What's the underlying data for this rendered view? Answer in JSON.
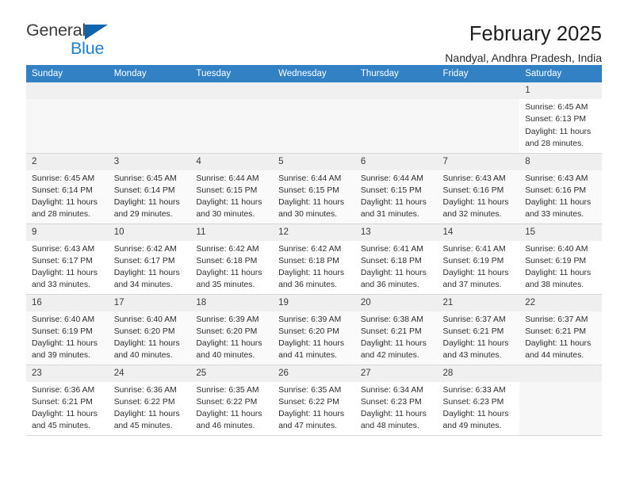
{
  "brand": {
    "name_part1": "General",
    "name_part2": "Blue",
    "accent_color": "#1f7fd0",
    "triangle_color": "#1263ad"
  },
  "header": {
    "title": "February 2025",
    "subtitle": "Nandyal, Andhra Pradesh, India"
  },
  "calendar": {
    "header_bg": "#3281c4",
    "weekdays": [
      "Sunday",
      "Monday",
      "Tuesday",
      "Wednesday",
      "Thursday",
      "Friday",
      "Saturday"
    ],
    "labels": {
      "sunrise": "Sunrise:",
      "sunset": "Sunset:",
      "daylight": "Daylight:"
    },
    "weeks": [
      [
        {
          "day": "",
          "empty": true
        },
        {
          "day": "",
          "empty": true
        },
        {
          "day": "",
          "empty": true
        },
        {
          "day": "",
          "empty": true
        },
        {
          "day": "",
          "empty": true
        },
        {
          "day": "",
          "empty": true
        },
        {
          "day": "1",
          "sunrise": "Sunrise: 6:45 AM",
          "sunset": "Sunset: 6:13 PM",
          "daylight1": "Daylight: 11 hours",
          "daylight2": "and 28 minutes."
        }
      ],
      [
        {
          "day": "2",
          "sunrise": "Sunrise: 6:45 AM",
          "sunset": "Sunset: 6:14 PM",
          "daylight1": "Daylight: 11 hours",
          "daylight2": "and 28 minutes."
        },
        {
          "day": "3",
          "sunrise": "Sunrise: 6:45 AM",
          "sunset": "Sunset: 6:14 PM",
          "daylight1": "Daylight: 11 hours",
          "daylight2": "and 29 minutes."
        },
        {
          "day": "4",
          "sunrise": "Sunrise: 6:44 AM",
          "sunset": "Sunset: 6:15 PM",
          "daylight1": "Daylight: 11 hours",
          "daylight2": "and 30 minutes."
        },
        {
          "day": "5",
          "sunrise": "Sunrise: 6:44 AM",
          "sunset": "Sunset: 6:15 PM",
          "daylight1": "Daylight: 11 hours",
          "daylight2": "and 30 minutes."
        },
        {
          "day": "6",
          "sunrise": "Sunrise: 6:44 AM",
          "sunset": "Sunset: 6:15 PM",
          "daylight1": "Daylight: 11 hours",
          "daylight2": "and 31 minutes."
        },
        {
          "day": "7",
          "sunrise": "Sunrise: 6:43 AM",
          "sunset": "Sunset: 6:16 PM",
          "daylight1": "Daylight: 11 hours",
          "daylight2": "and 32 minutes."
        },
        {
          "day": "8",
          "sunrise": "Sunrise: 6:43 AM",
          "sunset": "Sunset: 6:16 PM",
          "daylight1": "Daylight: 11 hours",
          "daylight2": "and 33 minutes."
        }
      ],
      [
        {
          "day": "9",
          "sunrise": "Sunrise: 6:43 AM",
          "sunset": "Sunset: 6:17 PM",
          "daylight1": "Daylight: 11 hours",
          "daylight2": "and 33 minutes."
        },
        {
          "day": "10",
          "sunrise": "Sunrise: 6:42 AM",
          "sunset": "Sunset: 6:17 PM",
          "daylight1": "Daylight: 11 hours",
          "daylight2": "and 34 minutes."
        },
        {
          "day": "11",
          "sunrise": "Sunrise: 6:42 AM",
          "sunset": "Sunset: 6:18 PM",
          "daylight1": "Daylight: 11 hours",
          "daylight2": "and 35 minutes."
        },
        {
          "day": "12",
          "sunrise": "Sunrise: 6:42 AM",
          "sunset": "Sunset: 6:18 PM",
          "daylight1": "Daylight: 11 hours",
          "daylight2": "and 36 minutes."
        },
        {
          "day": "13",
          "sunrise": "Sunrise: 6:41 AM",
          "sunset": "Sunset: 6:18 PM",
          "daylight1": "Daylight: 11 hours",
          "daylight2": "and 36 minutes."
        },
        {
          "day": "14",
          "sunrise": "Sunrise: 6:41 AM",
          "sunset": "Sunset: 6:19 PM",
          "daylight1": "Daylight: 11 hours",
          "daylight2": "and 37 minutes."
        },
        {
          "day": "15",
          "sunrise": "Sunrise: 6:40 AM",
          "sunset": "Sunset: 6:19 PM",
          "daylight1": "Daylight: 11 hours",
          "daylight2": "and 38 minutes."
        }
      ],
      [
        {
          "day": "16",
          "sunrise": "Sunrise: 6:40 AM",
          "sunset": "Sunset: 6:19 PM",
          "daylight1": "Daylight: 11 hours",
          "daylight2": "and 39 minutes."
        },
        {
          "day": "17",
          "sunrise": "Sunrise: 6:40 AM",
          "sunset": "Sunset: 6:20 PM",
          "daylight1": "Daylight: 11 hours",
          "daylight2": "and 40 minutes."
        },
        {
          "day": "18",
          "sunrise": "Sunrise: 6:39 AM",
          "sunset": "Sunset: 6:20 PM",
          "daylight1": "Daylight: 11 hours",
          "daylight2": "and 40 minutes."
        },
        {
          "day": "19",
          "sunrise": "Sunrise: 6:39 AM",
          "sunset": "Sunset: 6:20 PM",
          "daylight1": "Daylight: 11 hours",
          "daylight2": "and 41 minutes."
        },
        {
          "day": "20",
          "sunrise": "Sunrise: 6:38 AM",
          "sunset": "Sunset: 6:21 PM",
          "daylight1": "Daylight: 11 hours",
          "daylight2": "and 42 minutes."
        },
        {
          "day": "21",
          "sunrise": "Sunrise: 6:37 AM",
          "sunset": "Sunset: 6:21 PM",
          "daylight1": "Daylight: 11 hours",
          "daylight2": "and 43 minutes."
        },
        {
          "day": "22",
          "sunrise": "Sunrise: 6:37 AM",
          "sunset": "Sunset: 6:21 PM",
          "daylight1": "Daylight: 11 hours",
          "daylight2": "and 44 minutes."
        }
      ],
      [
        {
          "day": "23",
          "sunrise": "Sunrise: 6:36 AM",
          "sunset": "Sunset: 6:21 PM",
          "daylight1": "Daylight: 11 hours",
          "daylight2": "and 45 minutes."
        },
        {
          "day": "24",
          "sunrise": "Sunrise: 6:36 AM",
          "sunset": "Sunset: 6:22 PM",
          "daylight1": "Daylight: 11 hours",
          "daylight2": "and 45 minutes."
        },
        {
          "day": "25",
          "sunrise": "Sunrise: 6:35 AM",
          "sunset": "Sunset: 6:22 PM",
          "daylight1": "Daylight: 11 hours",
          "daylight2": "and 46 minutes."
        },
        {
          "day": "26",
          "sunrise": "Sunrise: 6:35 AM",
          "sunset": "Sunset: 6:22 PM",
          "daylight1": "Daylight: 11 hours",
          "daylight2": "and 47 minutes."
        },
        {
          "day": "27",
          "sunrise": "Sunrise: 6:34 AM",
          "sunset": "Sunset: 6:23 PM",
          "daylight1": "Daylight: 11 hours",
          "daylight2": "and 48 minutes."
        },
        {
          "day": "28",
          "sunrise": "Sunrise: 6:33 AM",
          "sunset": "Sunset: 6:23 PM",
          "daylight1": "Daylight: 11 hours",
          "daylight2": "and 49 minutes."
        },
        {
          "day": "",
          "empty": true
        }
      ]
    ]
  }
}
